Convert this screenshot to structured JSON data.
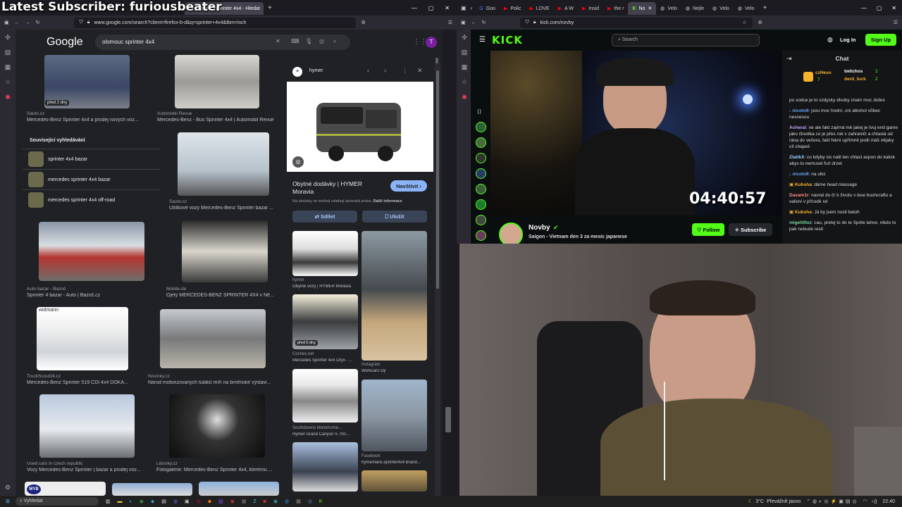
{
  "overlay": {
    "title": "Latest Subscriber: furiousbeater"
  },
  "left_browser": {
    "tabs": [
      {
        "label": "olomouc sprinter 4x4 - Hledat"
      }
    ],
    "url": "www.google.com/search?client=firefox-b-d&q=sprinter+4x4&tbm=isch",
    "search_value": "olomouc sprinter 4x4",
    "google_logo": "Google",
    "avatar_letter": "T",
    "results": [
      {
        "badge": "před 2 dny",
        "source": "Sauto.cz",
        "caption": "Mercedes-Benz Sprinter 4x4 a prodej nových voz..."
      },
      {
        "source": "Automobil Revue",
        "caption": "Mercedes-Benz - Bus Sprinter 4x4 | Automobil Revue"
      },
      {
        "source": "Sauto.cz",
        "caption": "Užitkové vozy Mercedes-Benz Sprinter bazar ..."
      },
      {
        "source": "Auto bazar - Bazoš",
        "caption": "Sprinter 4 bazar - Auto | Bazoš.cz"
      },
      {
        "source": "Mobile.de",
        "caption": "Ojetý MERCEDES-BENZ SPRINTER 4X4 v Ně..."
      },
      {
        "badge_text": "widmann",
        "source": "TruckScout24.cz",
        "caption": "Mercedes-Benz Sprinter 519 CDI 4x4 DOKA..."
      },
      {
        "source": "Novinky.cz",
        "caption": "Národ motorizovaných tuláků míří na brněnské výstavi..."
      },
      {
        "source": "Used cars in czech republic",
        "caption": "Vozy Mercedes-Benz Sprinter | bazar a prodej voz..."
      },
      {
        "source": "Lidovky.cz",
        "caption": "Fotogalerie: Mercedes-Benz Sprinter 4x4, kterému ..."
      }
    ],
    "related": {
      "title": "Související vyhledávání",
      "items": [
        {
          "label": "sprinter 4x4 bazar"
        },
        {
          "label": "mercedes sprinter 4x4 bazar"
        },
        {
          "label": "mercedes sprinter 4x4 off-road"
        }
      ]
    },
    "bottom_badge": "MYB",
    "side_panel": {
      "site": "hymer",
      "title": "Obytné dodávky | HYMER Moravia",
      "visit": "Navštívit",
      "notice": "Na obrázky se možná vztahují autorská práva.",
      "more_info": "Další informace",
      "share": "Sdílet",
      "save": "Uložit",
      "related": [
        {
          "source": "hymer",
          "caption": "Obytné vozy | HYMER Moravia"
        },
        {
          "source": "Instagram",
          "caption": "Workcars Oy"
        },
        {
          "badge": "před 5 dny",
          "source": "Coches.net",
          "caption": "Mercedes Sprinter 4x4 Oryx - ..."
        },
        {
          "source": "Southdowns Motorhome...",
          "caption": "Hymer Grand Canyon S 700..."
        },
        {
          "source": "Facebook",
          "caption": "hymerhans.sprinter4x4 Brand..."
        }
      ]
    }
  },
  "right_browser": {
    "tabs": [
      {
        "label": "Goo"
      },
      {
        "label": "Polic"
      },
      {
        "label": "LOVE"
      },
      {
        "label": "A W"
      },
      {
        "label": "Insid"
      },
      {
        "label": "the r"
      },
      {
        "label": "No"
      },
      {
        "label": "Velo"
      },
      {
        "label": "Nejle"
      },
      {
        "label": "Velo"
      },
      {
        "label": "Velo"
      }
    ],
    "url": "kick.com/novby",
    "kick_logo": "KICK",
    "search_placeholder": "Search",
    "login": "Log In",
    "signup": "Sign Up",
    "timer": "04:40:57",
    "streamer": "Novby",
    "stream_title": "Saigon - Vietnam den 3 za mesic japanese",
    "follow": "Follow",
    "subscribe": "Subscribe",
    "chat": {
      "title": "Chat",
      "top_users": [
        {
          "name": "czHeso",
          "count": "7"
        },
        {
          "name": "twitchos",
          "count": "2"
        },
        {
          "name": "derd_luck",
          "count": "2"
        }
      ],
      "messages": [
        {
          "user": "",
          "text": "po vodce je to vzdycky divoky znam moc dobre"
        },
        {
          "user": "nicoto9",
          "text": "jsou moc hodní, oni alkohol vůbec nesnesou"
        },
        {
          "user": "Acheral",
          "text": "ne ale fakt zajímá mě jakej je tvuj end game jako člověka co je přes rok v zahraničí a chlastá od rána do večera, fakt řekni upřímně jestli máš nějaky cíl chapeš"
        },
        {
          "user": "ZlatikX",
          "text": "co kdyby sis nalil ten chlast aspon do kalisk abys to nemusel furt drzet"
        },
        {
          "user": "nicoto9",
          "text": "na ulici"
        },
        {
          "user": "Kubsha",
          "text": "dáme head massage"
        },
        {
          "user": "Davam1r",
          "text": "navrat do čr k životu v lese bushcraftu a vaření v přírodě xd"
        },
        {
          "user": "Kubsha",
          "text": "Já by jsem nosil batoh"
        },
        {
          "user": "migelit0oz",
          "text": "cau, prelej to do te Sprite lahve, nikdo to pak nebude resit"
        }
      ]
    }
  },
  "taskbar": {
    "search": "Vyhledat",
    "weather": "3°C",
    "weather_text": "Převážně jasno",
    "time": "22:40"
  },
  "colors": {
    "kick_green": "#53fc18",
    "google_bg": "#202124",
    "chrome_dark": "#1c1b22"
  }
}
